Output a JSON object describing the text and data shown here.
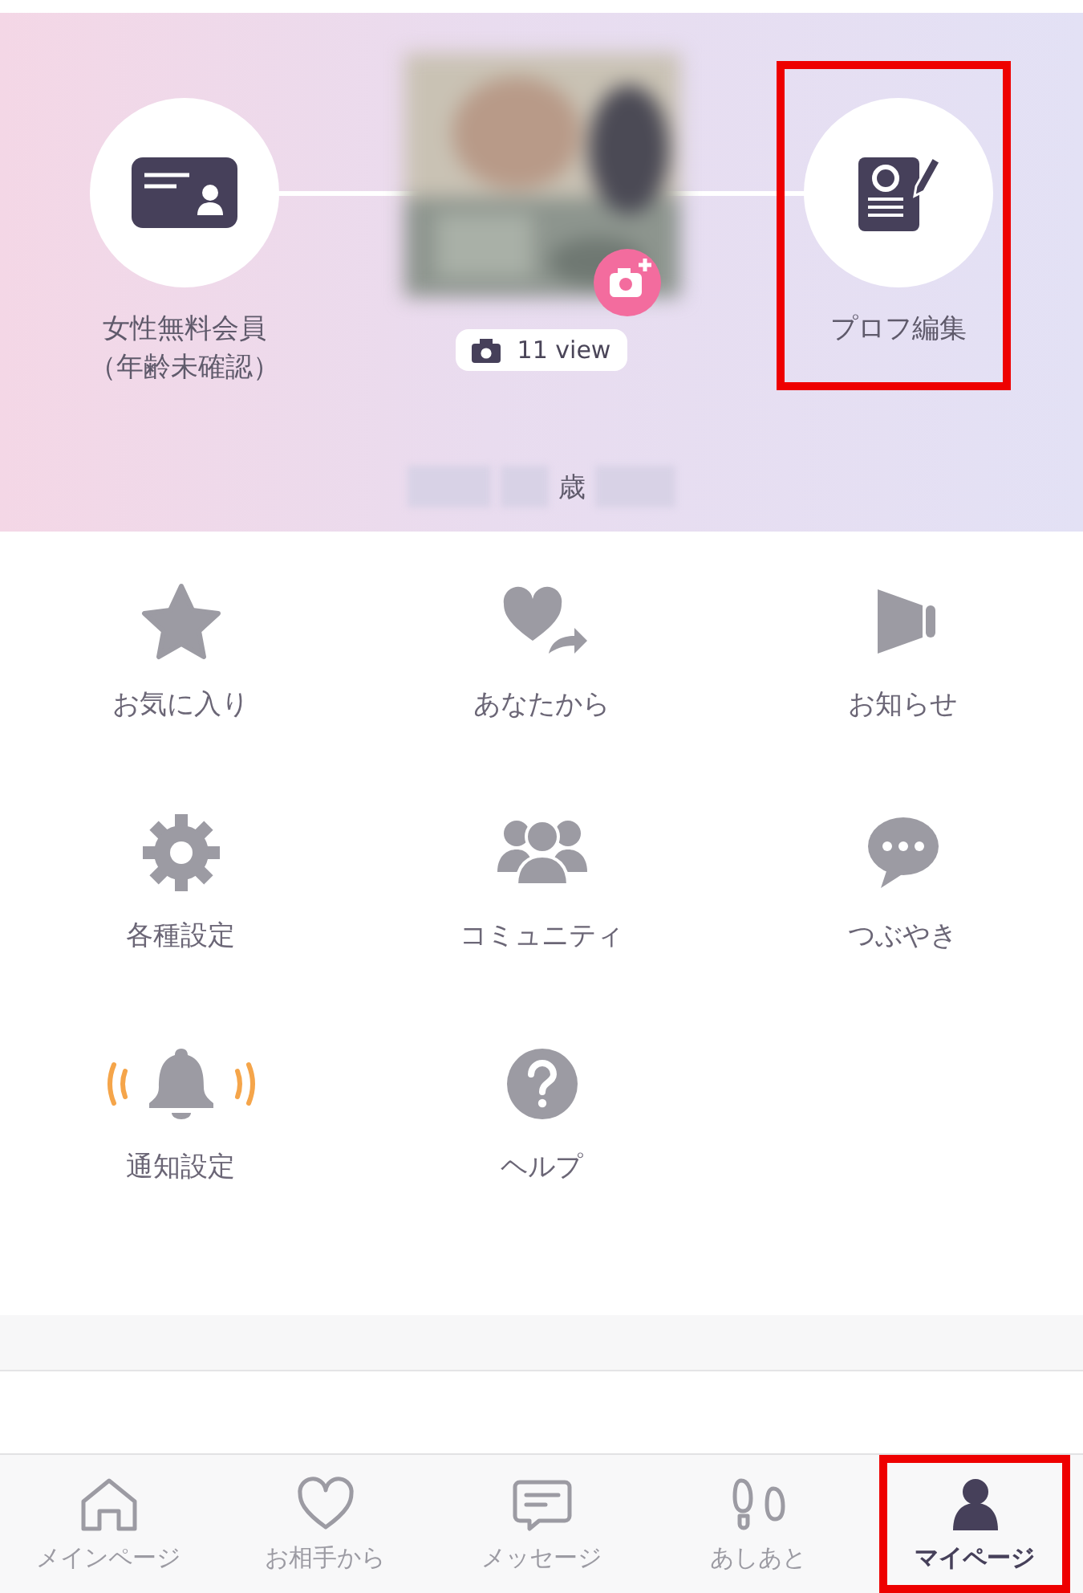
{
  "profile_header": {
    "membership": {
      "lines": [
        "女性無料会員",
        "（年齢未確認）"
      ]
    },
    "photo": {
      "views": "11 view"
    },
    "age_suffix": "歳",
    "edit_profile": {
      "label": "プロフ編集",
      "highlighted": true
    }
  },
  "menu": [
    {
      "kind": "star",
      "label": "お気に入り"
    },
    {
      "kind": "heart-send",
      "label": "あなたから"
    },
    {
      "kind": "megaphone",
      "label": "お知らせ"
    },
    {
      "kind": "gear",
      "label": "各種設定"
    },
    {
      "kind": "group",
      "label": "コミュニティ"
    },
    {
      "kind": "chat",
      "label": "つぶやき"
    },
    {
      "kind": "bell",
      "label": "通知設定"
    },
    {
      "kind": "help",
      "label": "ヘルプ"
    }
  ],
  "tab_bar": [
    {
      "kind": "home",
      "label": "メインページ",
      "selected": false,
      "highlighted": false
    },
    {
      "kind": "heart",
      "label": "お相手から",
      "selected": false,
      "highlighted": false
    },
    {
      "kind": "message",
      "label": "メッセージ",
      "selected": false,
      "highlighted": false
    },
    {
      "kind": "footprints",
      "label": "あしあと",
      "selected": false,
      "highlighted": false
    },
    {
      "kind": "person",
      "label": "マイページ",
      "selected": true,
      "highlighted": true
    }
  ]
}
